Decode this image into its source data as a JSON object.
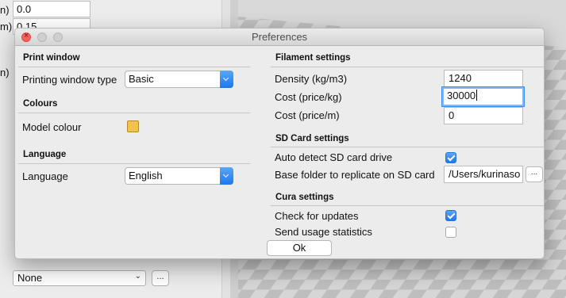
{
  "background": {
    "fields": [
      "0.0",
      "0.15"
    ],
    "fragments": [
      "n)",
      "m)",
      "n)"
    ],
    "support_select": "None",
    "more_button": "..."
  },
  "dialog": {
    "title": "Preferences",
    "ok_label": "Ok",
    "print_window": {
      "title": "Print window",
      "type_label": "Printing window type",
      "type_value": "Basic"
    },
    "colours": {
      "title": "Colours",
      "model_colour_label": "Model colour",
      "model_colour": "#f0c24e"
    },
    "language": {
      "title": "Language",
      "label": "Language",
      "value": "English"
    },
    "filament": {
      "title": "Filament settings",
      "density_label": "Density (kg/m3)",
      "density_value": "1240",
      "cost_kg_label": "Cost (price/kg)",
      "cost_kg_value": "30000",
      "cost_m_label": "Cost (price/m)",
      "cost_m_value": "0"
    },
    "sd_card": {
      "title": "SD Card settings",
      "auto_detect_label": "Auto detect SD card drive",
      "auto_detect_checked": true,
      "base_folder_label": "Base folder to replicate on SD card",
      "base_folder_value": "/Users/kurinaso",
      "browse_label": "..."
    },
    "cura": {
      "title": "Cura settings",
      "updates_label": "Check for updates",
      "updates_checked": true,
      "usage_label": "Send usage statistics",
      "usage_checked": false
    }
  },
  "colors": {
    "accent": "#1f77ec",
    "close_button": "#fc605c",
    "swatch": "#f0c24e"
  }
}
